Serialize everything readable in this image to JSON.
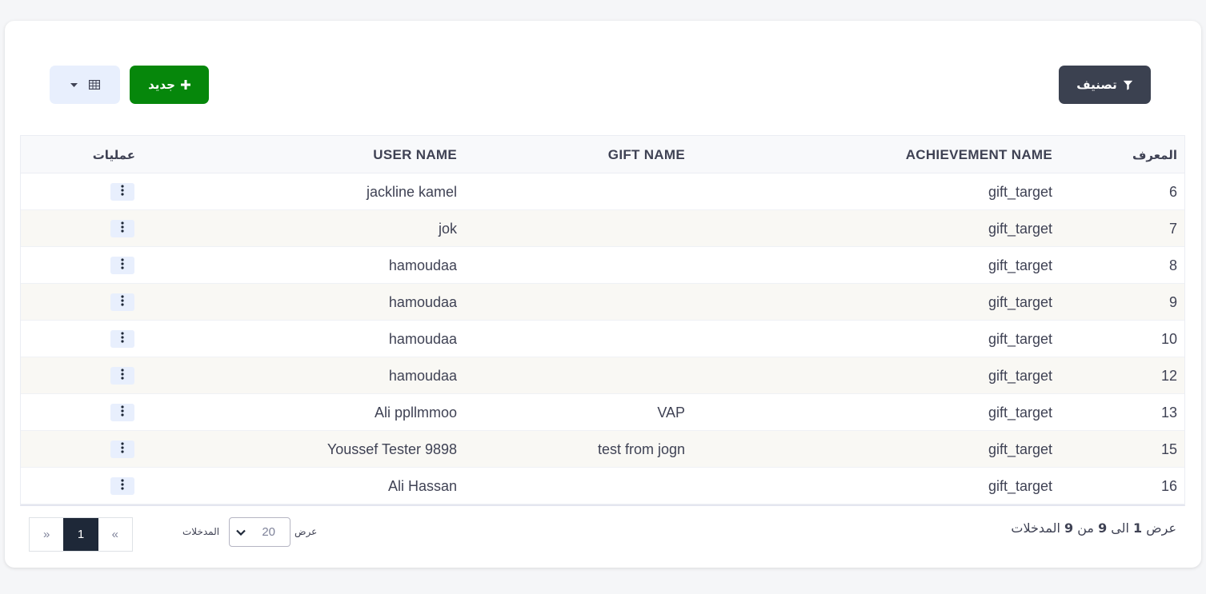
{
  "toolbar": {
    "filter_label": "تصنيف",
    "new_label": "جديد"
  },
  "table": {
    "headers": {
      "id": "المعرف",
      "achievement": "ACHIEVEMENT NAME",
      "gift": "GIFT NAME",
      "user": "USER NAME",
      "ops": "عمليات"
    },
    "rows": [
      {
        "id": "6",
        "achievement": "gift_target",
        "gift": "",
        "user": "jackline kamel"
      },
      {
        "id": "7",
        "achievement": "gift_target",
        "gift": "",
        "user": "jok"
      },
      {
        "id": "8",
        "achievement": "gift_target",
        "gift": "",
        "user": "hamoudaa"
      },
      {
        "id": "9",
        "achievement": "gift_target",
        "gift": "",
        "user": "hamoudaa"
      },
      {
        "id": "10",
        "achievement": "gift_target",
        "gift": "",
        "user": "hamoudaa"
      },
      {
        "id": "12",
        "achievement": "gift_target",
        "gift": "",
        "user": "hamoudaa"
      },
      {
        "id": "13",
        "achievement": "gift_target",
        "gift": "VAP",
        "user": "Ali ppllmmoo"
      },
      {
        "id": "15",
        "achievement": "gift_target",
        "gift": "test from jogn",
        "user": "Youssef Tester 9898"
      },
      {
        "id": "16",
        "achievement": "gift_target",
        "gift": "",
        "user": "Ali Hassan"
      }
    ]
  },
  "footer": {
    "info_prefix": "عرض",
    "info_from": "1",
    "info_to_word": "الى",
    "info_to": "9",
    "info_of_word": "من",
    "info_total": "9",
    "info_suffix": "المدخلات",
    "length_show_label": "عرض",
    "length_value": "20",
    "length_entries_label": "المدخلات",
    "pager_prev": "«",
    "pager_current": "1",
    "pager_next": "»"
  },
  "colors": {
    "filter_button": "#3b4150",
    "new_button": "#06870b",
    "view_button": "#e8effd",
    "pager_active": "#1e2838",
    "row_stripe": "#f9f8f4"
  }
}
